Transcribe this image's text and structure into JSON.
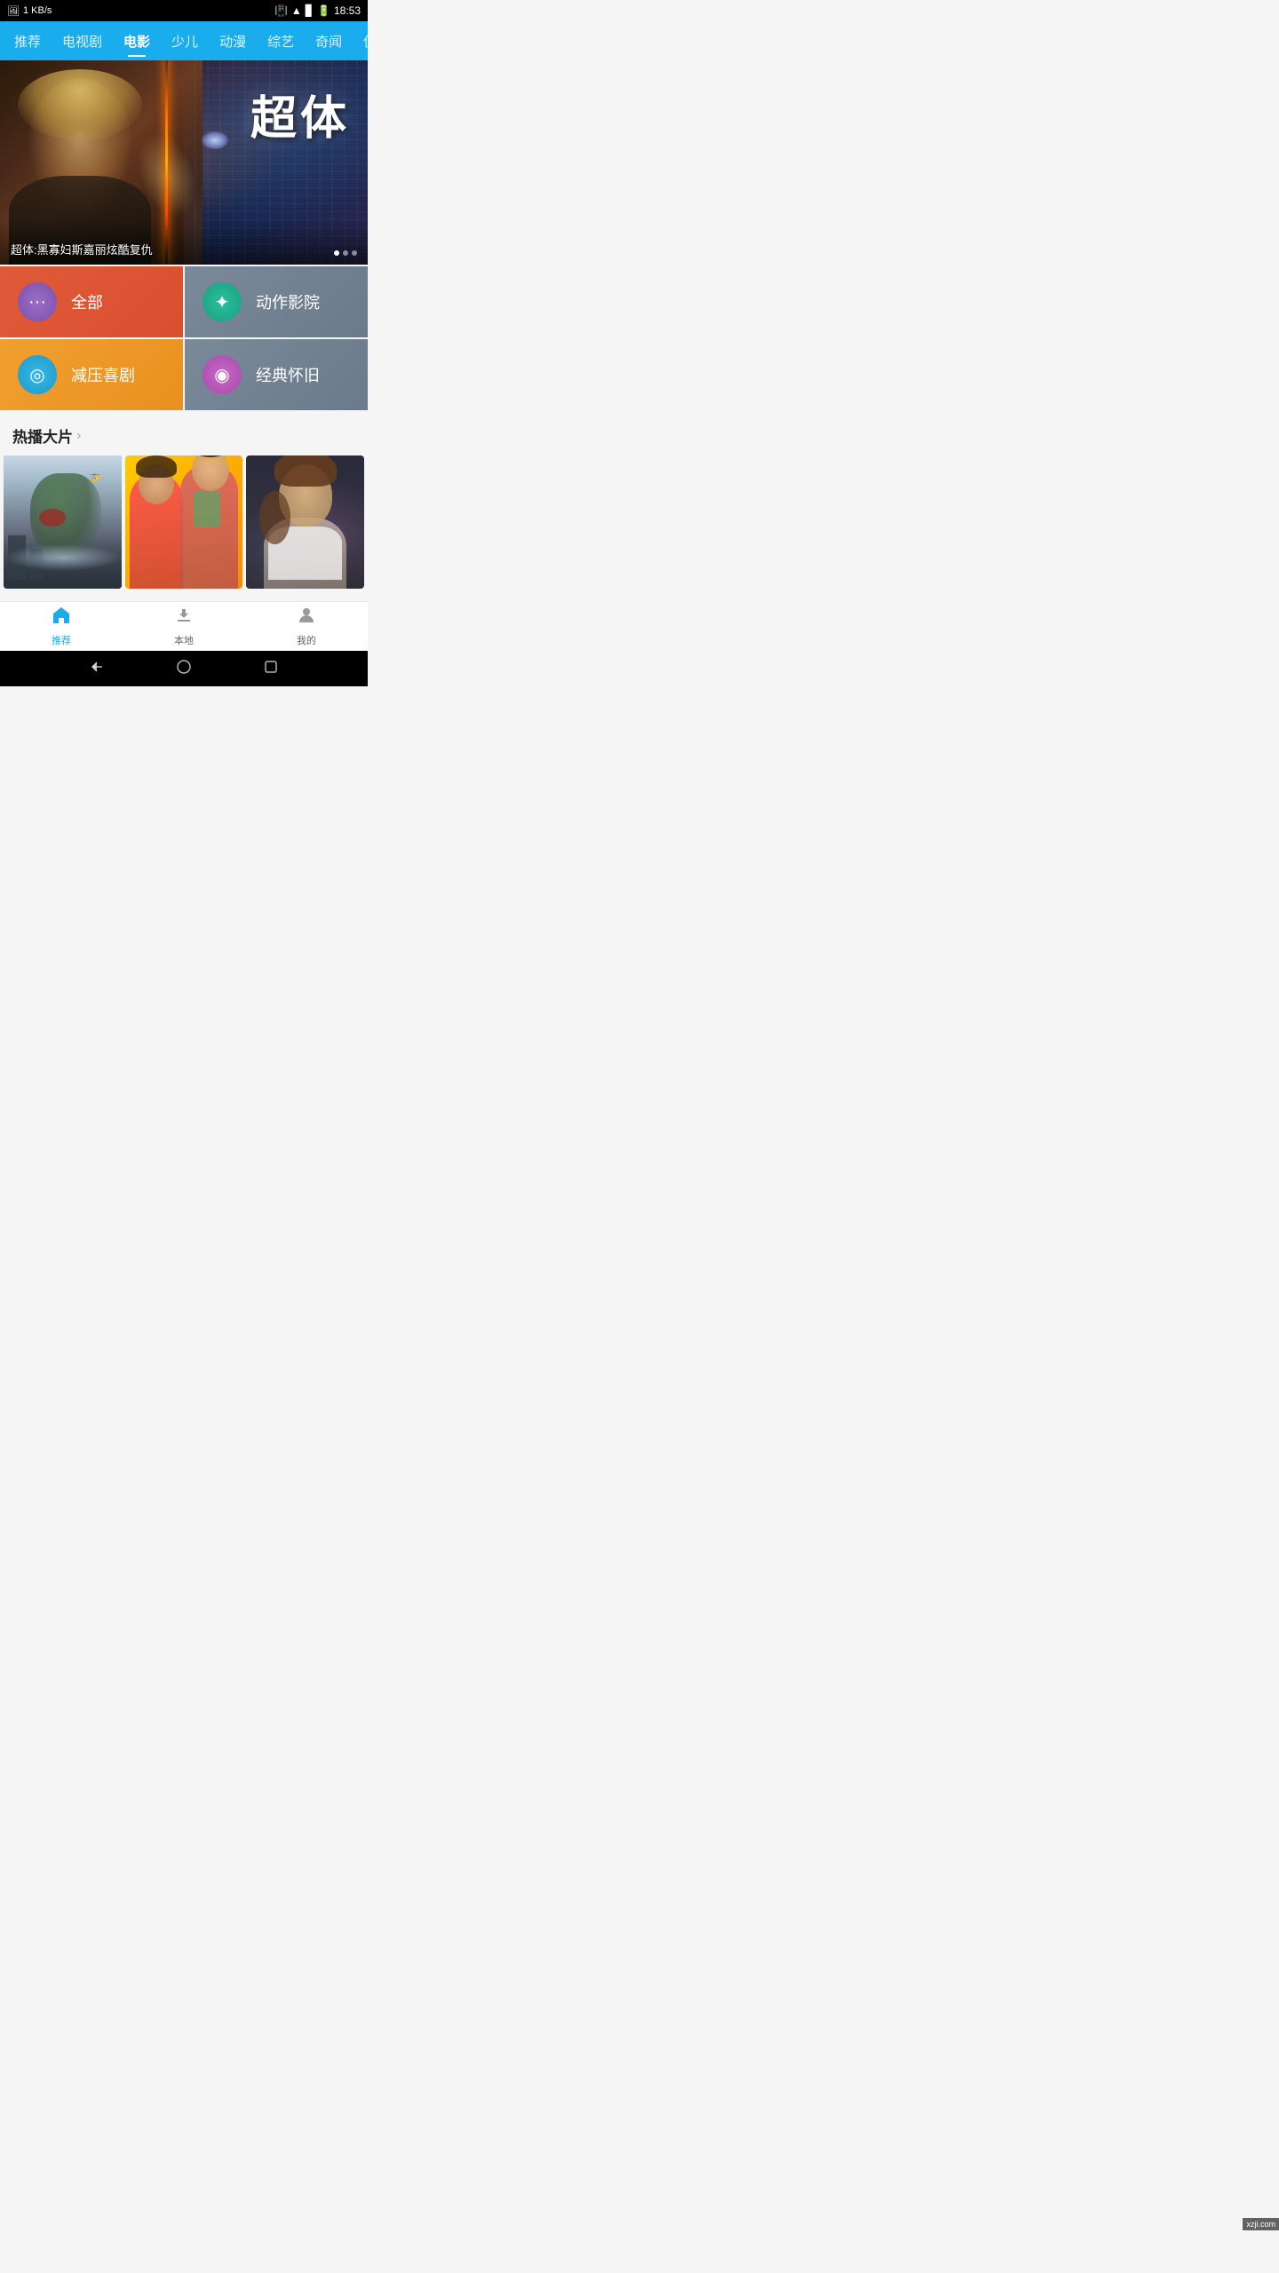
{
  "statusBar": {
    "network": "1 KB/s",
    "time": "18:53"
  },
  "nav": {
    "tabs": [
      {
        "id": "recommend",
        "label": "推荐",
        "active": false
      },
      {
        "id": "tv",
        "label": "电视剧",
        "active": false
      },
      {
        "id": "movie",
        "label": "电影",
        "active": true
      },
      {
        "id": "kids",
        "label": "少儿",
        "active": false
      },
      {
        "id": "anime",
        "label": "动漫",
        "active": false
      },
      {
        "id": "variety",
        "label": "综艺",
        "active": false
      },
      {
        "id": "news",
        "label": "奇闻",
        "active": false
      },
      {
        "id": "more",
        "label": "侃",
        "active": false
      }
    ]
  },
  "hero": {
    "title": "超体",
    "caption": "超体:黑寡妇斯嘉丽炫酷复仇",
    "dots": 3,
    "activeDot": 0
  },
  "categories": [
    {
      "id": "all",
      "label": "全部",
      "icon": "···",
      "iconClass": "icon-all",
      "bgClass": "cat-all"
    },
    {
      "id": "action",
      "label": "动作影院",
      "icon": "✦",
      "iconClass": "icon-action",
      "bgClass": "cat-action"
    },
    {
      "id": "comedy",
      "label": "减压喜剧",
      "icon": "◎",
      "iconClass": "icon-comedy",
      "bgClass": "cat-comedy"
    },
    {
      "id": "classic",
      "label": "经典怀旧",
      "icon": "◉",
      "iconClass": "icon-classic",
      "bgClass": "cat-classic"
    }
  ],
  "hotSection": {
    "title": "热播大片",
    "arrow": "›"
  },
  "bottomNav": {
    "items": [
      {
        "id": "recommend",
        "label": "推荐",
        "icon": "⌂",
        "active": true
      },
      {
        "id": "local",
        "label": "本地",
        "icon": "↧",
        "active": false
      },
      {
        "id": "mine",
        "label": "我的",
        "icon": "👤",
        "active": false
      }
    ]
  },
  "watermark": "xzji.com"
}
